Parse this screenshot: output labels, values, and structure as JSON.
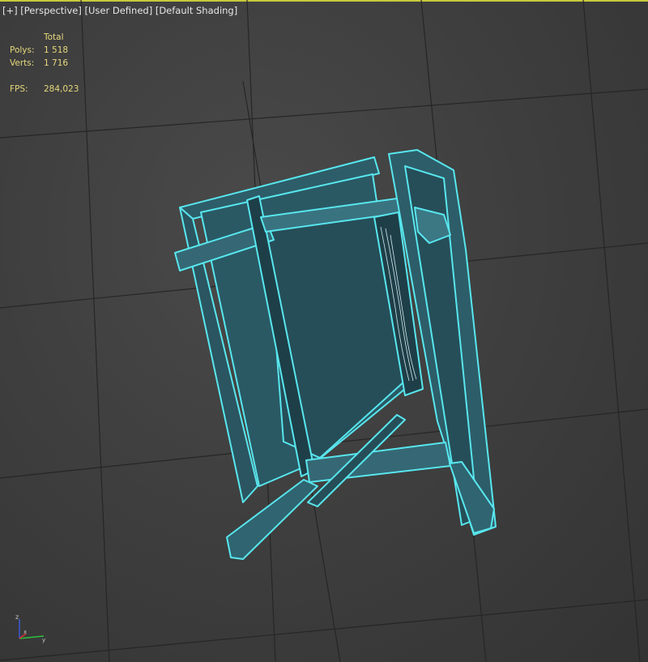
{
  "viewport": {
    "menu_plus": "[+]",
    "view_mode": "[Perspective]",
    "shading_user": "[User Defined]",
    "shading_mode": "[Default Shading]"
  },
  "stats": {
    "total_label": "Total",
    "polys_label": "Polys:",
    "polys_value": "1 518",
    "verts_label": "Verts:",
    "verts_value": "1 716",
    "fps_label": "FPS:",
    "fps_value": "284,023"
  },
  "colors": {
    "background": "#3f3f3f",
    "grid": "#2a2a2a",
    "selection_wire": "#58e6ee",
    "model_fill": "#2b5560",
    "stats_text": "#e6d87c",
    "viewport_border": "#c8c83c"
  },
  "axis_gizmo": {
    "z": "z",
    "x": "x",
    "y": "y"
  }
}
